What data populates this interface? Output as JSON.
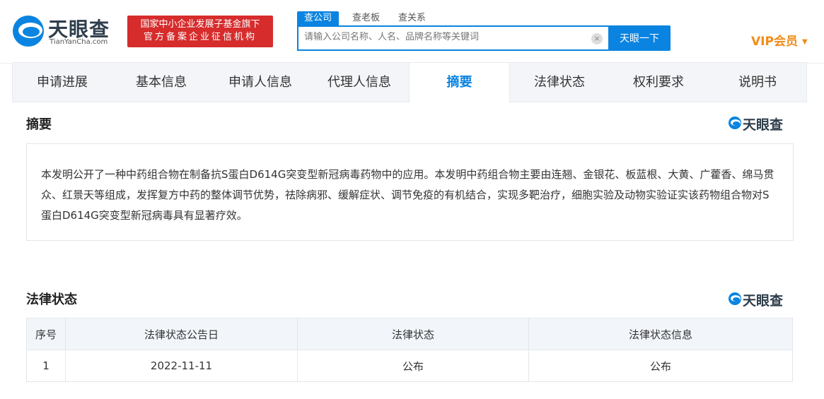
{
  "brand": {
    "name_cn": "天眼查",
    "name_en": "TianYanCha.com",
    "badge_line1": "国家中小企业发展子基金旗下",
    "badge_line2": "官方备案企业征信机构"
  },
  "search": {
    "tabs": [
      "查公司",
      "查老板",
      "查关系"
    ],
    "active_tab": "查公司",
    "placeholder": "请输入公司名称、人名、品牌名称等关键词",
    "button_label": "天眼一下",
    "clear_glyph": "×"
  },
  "vip": {
    "label": "VIP会员",
    "arrow": "▼"
  },
  "nav_tabs": [
    {
      "label": "申请进展"
    },
    {
      "label": "基本信息"
    },
    {
      "label": "申请人信息"
    },
    {
      "label": "代理人信息"
    },
    {
      "label": "摘要"
    },
    {
      "label": "法律状态"
    },
    {
      "label": "权利要求"
    },
    {
      "label": "说明书"
    }
  ],
  "abstract": {
    "title": "摘要",
    "brand": "天眼查",
    "text": "本发明公开了一种中药组合物在制备抗S蛋白D614G突变型新冠病毒药物中的应用。本发明中药组合物主要由连翘、金银花、板蓝根、大黄、广藿香、绵马贯众、红景天等组成，发挥复方中药的整体调节优势，祛除病邪、缓解症状、调节免疫的有机结合，实现多靶治疗，细胞实验及动物实验证实该药物组合物对S蛋白D614G突变型新冠病毒具有显著疗效。"
  },
  "legal": {
    "title": "法律状态",
    "brand": "天眼查",
    "columns": [
      "序号",
      "法律状态公告日",
      "法律状态",
      "法律状态信息"
    ],
    "rows": [
      {
        "index": "1",
        "date": "2022-11-11",
        "status": "公布",
        "info": "公布"
      }
    ]
  },
  "colors": {
    "accent": "#0a84e0",
    "badge_red": "#d62c2c",
    "vip_orange": "#f08c1a"
  }
}
